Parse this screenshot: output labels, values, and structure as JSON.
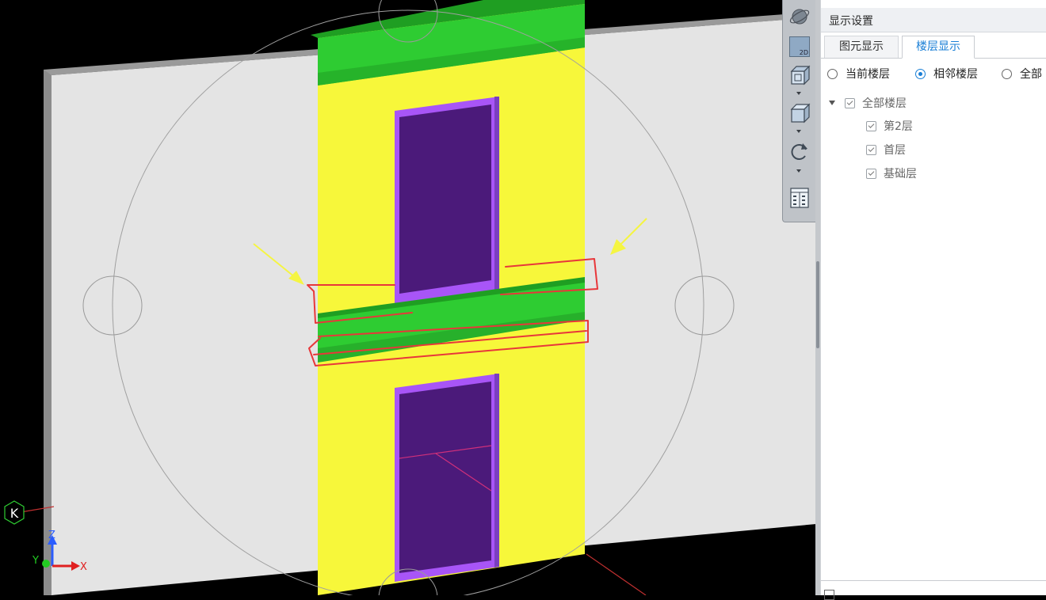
{
  "viewport": {
    "axis_labels": {
      "x": "X",
      "y": "Y",
      "z": "Z"
    },
    "nav_label": "K",
    "colors": {
      "background": "#000000",
      "wall": "#e4e4e4",
      "column": "#f7f73a",
      "beam": "#2ecc32",
      "window_frame": "#a855f7",
      "window_glass": "#4b1a7a",
      "annotation": "#e8373a",
      "arrow": "#f5f542"
    }
  },
  "toolbar": {
    "view_2d_label": "2D",
    "icons": [
      "orbit-icon",
      "view-2d-icon",
      "view-cube-top-icon",
      "view-cube-icon",
      "rotate-icon",
      "display-settings-icon"
    ]
  },
  "panel": {
    "title": "显示设置",
    "tabs": [
      {
        "label": "图元显示",
        "active": false
      },
      {
        "label": "楼层显示",
        "active": true
      }
    ],
    "radios": [
      {
        "label": "当前楼层",
        "selected": false
      },
      {
        "label": "相邻楼层",
        "selected": true
      },
      {
        "label": "全部",
        "selected": false
      }
    ],
    "tree": {
      "root": {
        "label": "全部楼层",
        "checked": true
      },
      "children": [
        {
          "label": "第2层",
          "checked": true
        },
        {
          "label": "首层",
          "checked": true
        },
        {
          "label": "基础层",
          "checked": true
        }
      ]
    }
  }
}
